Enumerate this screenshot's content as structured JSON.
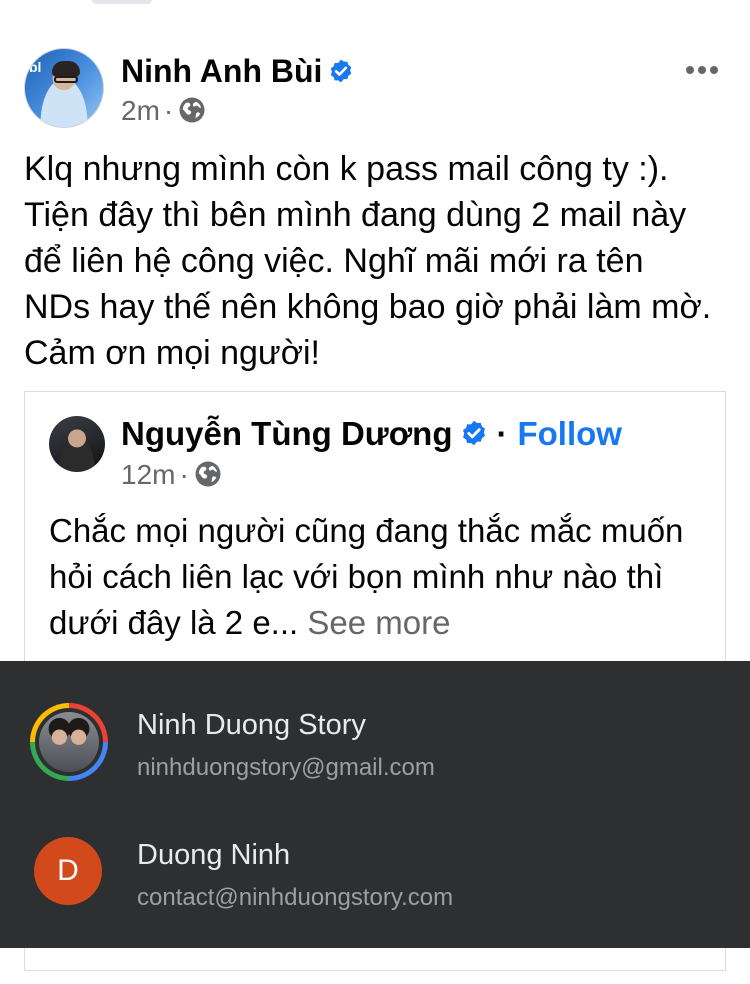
{
  "post": {
    "author": "Ninh Anh Bùi",
    "time": "2m",
    "separator": "·",
    "text": "Klq nhưng mình còn k pass mail công ty :). Tiện đây thì bên mình đang dùng 2 mail này để liên hệ công việc. Nghĩ mãi mới ra tên NDs hay thế nên không bao giờ phải làm mờ. Cảm ơn mọi người!",
    "avatar_text": "bl"
  },
  "shared_post": {
    "author": "Nguyễn Tùng Dương",
    "separator": "·",
    "follow_label": "Follow",
    "time": "12m",
    "text": "Chắc mọi người cũng đang thắc mắc muốn hỏi cách liên lạc với bọn mình như nào thì dưới đây là 2 e...",
    "see_more_label": "See more"
  },
  "accounts": [
    {
      "name": "Ninh Duong Story",
      "email": "ninhduongstory@gmail.com"
    },
    {
      "name": "Duong Ninh",
      "email": "contact@ninhduongstory.com",
      "initial": "D"
    }
  ],
  "icons": {
    "verified": "verified-badge-icon",
    "audience": "globe-icon",
    "more": "more-options-icon"
  },
  "colors": {
    "accent": "#1877f2",
    "panel_bg": "#2e2f31",
    "secondary_text": "#65676b"
  }
}
